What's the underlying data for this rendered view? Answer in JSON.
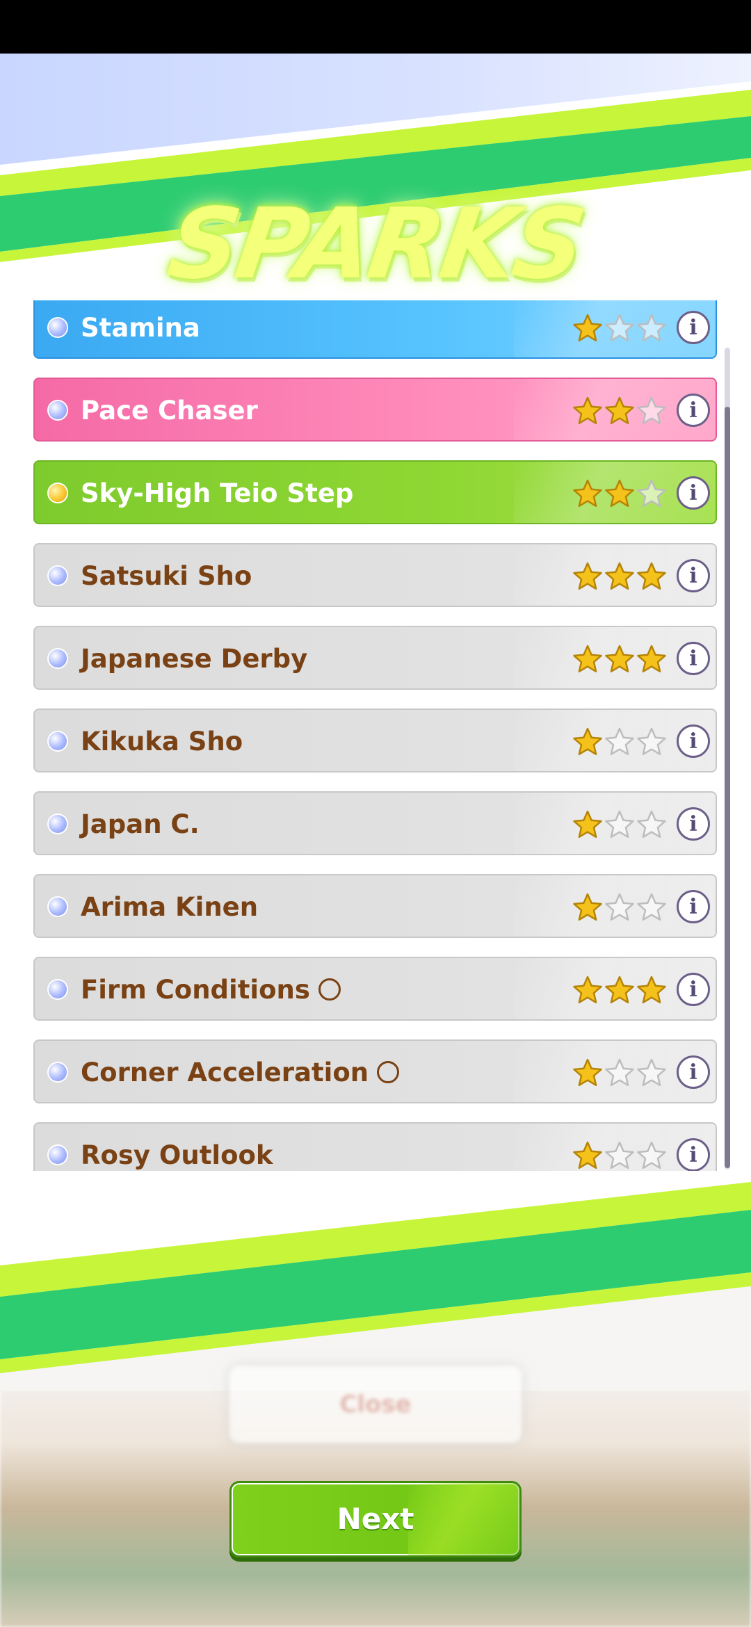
{
  "title": "SPARKS",
  "colors": {
    "blue_row": "#3aa9f2",
    "pink_row": "#f56aa6",
    "green_row": "#7ecb2d",
    "grey_row": "#dcdcdc",
    "star_gold": "#f5b400",
    "label_brown": "#7a4214",
    "stripe_green": "#2ecc71",
    "stripe_lime": "#c6f53a"
  },
  "sparks": [
    {
      "label": "Stamina",
      "type": "blue",
      "dot": "blue",
      "stars": 1,
      "circle": false
    },
    {
      "label": "Pace Chaser",
      "type": "pink",
      "dot": "blue",
      "stars": 2,
      "circle": false
    },
    {
      "label": "Sky-High Teio Step",
      "type": "green",
      "dot": "gold",
      "stars": 2,
      "circle": false
    },
    {
      "label": "Satsuki Sho",
      "type": "grey",
      "dot": "blue",
      "stars": 3,
      "circle": false
    },
    {
      "label": "Japanese Derby",
      "type": "grey",
      "dot": "blue",
      "stars": 3,
      "circle": false
    },
    {
      "label": "Kikuka Sho",
      "type": "grey",
      "dot": "blue",
      "stars": 1,
      "circle": false
    },
    {
      "label": "Japan C.",
      "type": "grey",
      "dot": "blue",
      "stars": 1,
      "circle": false
    },
    {
      "label": "Arima Kinen",
      "type": "grey",
      "dot": "blue",
      "stars": 1,
      "circle": false
    },
    {
      "label": "Firm Conditions",
      "type": "grey",
      "dot": "blue",
      "stars": 3,
      "circle": true
    },
    {
      "label": "Corner Acceleration",
      "type": "grey",
      "dot": "blue",
      "stars": 1,
      "circle": true
    },
    {
      "label": "Rosy Outlook",
      "type": "grey",
      "dot": "blue",
      "stars": 1,
      "circle": false
    }
  ],
  "info_icon": "i",
  "buttons": {
    "close_label": "Close",
    "next_label": "Next"
  }
}
